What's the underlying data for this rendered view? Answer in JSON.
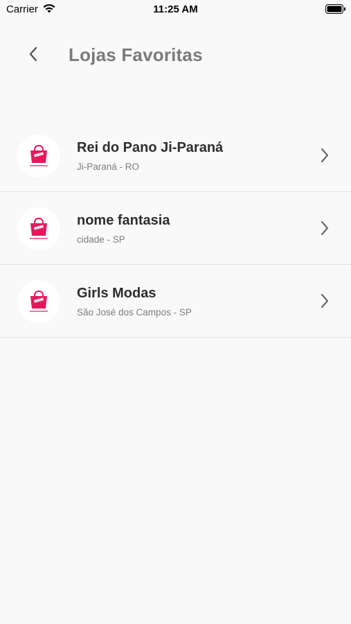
{
  "status_bar": {
    "carrier": "Carrier",
    "time": "11:25 AM"
  },
  "header": {
    "title": "Lojas Favoritas"
  },
  "stores": [
    {
      "name": "Rei do Pano Ji-Paraná",
      "location": "Ji-Paraná - RO"
    },
    {
      "name": "nome fantasia",
      "location": "cidade - SP"
    },
    {
      "name": "Girls Modas",
      "location": "São José dos Campos - SP"
    }
  ],
  "colors": {
    "background": "#f9f9f9",
    "title": "#7a7a7a",
    "brand_pink": "#e8175d"
  },
  "icons": {
    "back": "chevron-left-icon",
    "row_arrow": "chevron-right-icon",
    "logo": "shopping-bag-logo"
  }
}
